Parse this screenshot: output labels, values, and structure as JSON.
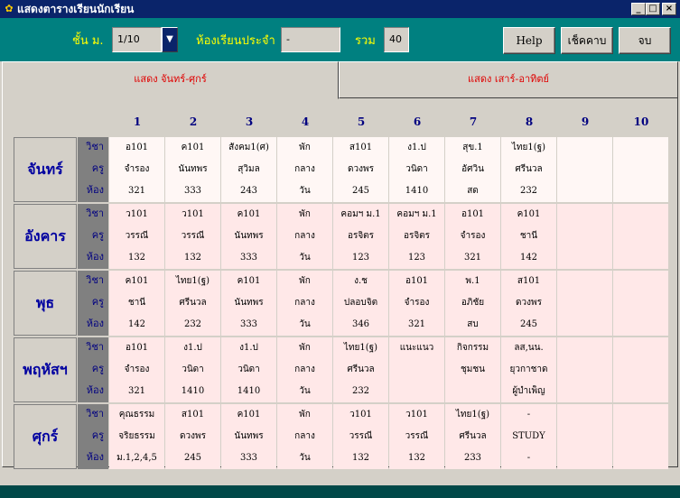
{
  "window": {
    "title": "แสดงตารางเรียนนักเรียน",
    "icon": "app-icon"
  },
  "toolbar": {
    "grade_label": "ชั้น ม.",
    "grade_value": "1/10",
    "homeroom_label": "ห้องเรียนประจำ",
    "homeroom_value": "-",
    "total_label": "รวม",
    "total_value": "40",
    "help_label": "Help",
    "check_label": "เช็คคาบ",
    "end_label": "จบ"
  },
  "tabs": [
    "แสดง จันทร์-ศุกร์",
    "แสดง เสาร์-อาทิตย์"
  ],
  "periods": [
    "1",
    "2",
    "3",
    "4",
    "5",
    "6",
    "7",
    "8",
    "9",
    "10"
  ],
  "row_labels": [
    "วิชา",
    "ครู",
    "ห้อง"
  ],
  "days": [
    {
      "name": "จันทร์",
      "cells": [
        [
          "อ101",
          "จำรอง",
          "321"
        ],
        [
          "ค101",
          "นันทพร",
          "333"
        ],
        [
          "สังคม1(ศ)",
          "สุวิมล",
          "243"
        ],
        [
          "พัก",
          "กลาง",
          "วัน"
        ],
        [
          "ส101",
          "ดวงพร",
          "245"
        ],
        [
          "ง1.ป",
          "วนิดา",
          "1410"
        ],
        [
          "สุข.1",
          "อัศวิน",
          "สด"
        ],
        [
          "ไทย1(ฐ)",
          "ศรีนวล",
          "232"
        ],
        [
          "",
          "",
          ""
        ],
        [
          "",
          "",
          ""
        ]
      ]
    },
    {
      "name": "อังคาร",
      "cells": [
        [
          "ว101",
          "วรรณี",
          "132"
        ],
        [
          "ว101",
          "วรรณี",
          "132"
        ],
        [
          "ค101",
          "นันทพร",
          "333"
        ],
        [
          "พัก",
          "กลาง",
          "วัน"
        ],
        [
          "คอมฯ ม.1",
          "อรจิตร",
          "123"
        ],
        [
          "คอมฯ ม.1",
          "อรจิตร",
          "123"
        ],
        [
          "อ101",
          "จำรอง",
          "321"
        ],
        [
          "ค101",
          "ชานี",
          "142"
        ],
        [
          "",
          "",
          ""
        ],
        [
          "",
          "",
          ""
        ]
      ]
    },
    {
      "name": "พุธ",
      "cells": [
        [
          "ค101",
          "ชานี",
          "142"
        ],
        [
          "ไทย1(ฐ)",
          "ศรีนวล",
          "232"
        ],
        [
          "ค101",
          "นันทพร",
          "333"
        ],
        [
          "พัก",
          "กลาง",
          "วัน"
        ],
        [
          "ง.ช",
          "ปลอบจิต",
          "346"
        ],
        [
          "อ101",
          "จำรอง",
          "321"
        ],
        [
          "พ.1",
          "อภิชัย",
          "สบ"
        ],
        [
          "ส101",
          "ดวงพร",
          "245"
        ],
        [
          "",
          "",
          ""
        ],
        [
          "",
          "",
          ""
        ]
      ]
    },
    {
      "name": "พฤหัสฯ",
      "cells": [
        [
          "อ101",
          "จำรอง",
          "321"
        ],
        [
          "ง1.ป",
          "วนิดา",
          "1410"
        ],
        [
          "ง1.ป",
          "วนิดา",
          "1410"
        ],
        [
          "พัก",
          "กลาง",
          "วัน"
        ],
        [
          "ไทย1(ฐ)",
          "ศรีนวล",
          "232"
        ],
        [
          "แนะแนว",
          "",
          ""
        ],
        [
          "กิจกรรม",
          "ชุมชน",
          ""
        ],
        [
          "ลส,นน.",
          "ยุวกาชาด",
          "ผู้บำเพ็ญ"
        ],
        [
          "",
          "",
          ""
        ],
        [
          "",
          "",
          ""
        ]
      ]
    },
    {
      "name": "ศุกร์",
      "cells": [
        [
          "คุณธรรม",
          "จริยธรรม",
          "ม.1,2,4,5"
        ],
        [
          "ส101",
          "ดวงพร",
          "245"
        ],
        [
          "ค101",
          "นันทพร",
          "333"
        ],
        [
          "พัก",
          "กลาง",
          "วัน"
        ],
        [
          "ว101",
          "วรรณี",
          "132"
        ],
        [
          "ว101",
          "วรรณี",
          "132"
        ],
        [
          "ไทย1(ฐ)",
          "ศรีนวล",
          "233"
        ],
        [
          "-",
          "STUDY",
          "-"
        ],
        [
          "",
          "",
          ""
        ],
        [
          "",
          "",
          ""
        ]
      ]
    }
  ]
}
